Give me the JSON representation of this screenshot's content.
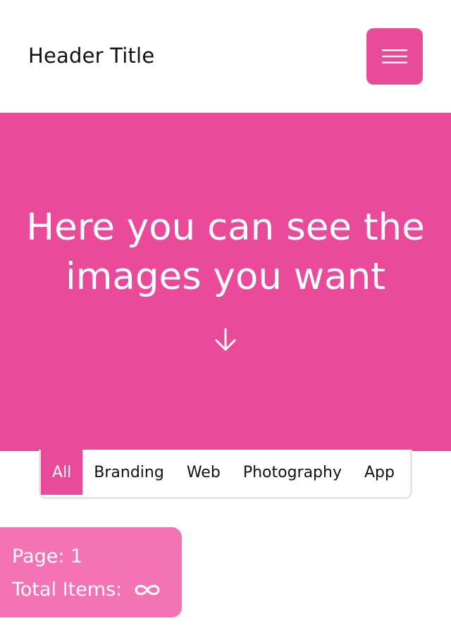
{
  "header": {
    "title": "Header Title",
    "menu_icon": "hamburger-menu-icon"
  },
  "hero": {
    "title_line1": "Here you can see the",
    "title_line2": "images you want",
    "arrow_icon": "arrow-down-icon"
  },
  "filters": {
    "tabs": [
      {
        "label": "All",
        "active": true
      },
      {
        "label": "Branding",
        "active": false
      },
      {
        "label": "Web",
        "active": false
      },
      {
        "label": "Photography",
        "active": false
      },
      {
        "label": "App",
        "active": false
      }
    ]
  },
  "pagination": {
    "page_text": "Page: 1",
    "total_label": "Total Items:",
    "total_icon": "infinity-icon"
  },
  "colors": {
    "accent": "#ea4a9a",
    "card": "#f472b6",
    "border": "#e4e4ea"
  }
}
